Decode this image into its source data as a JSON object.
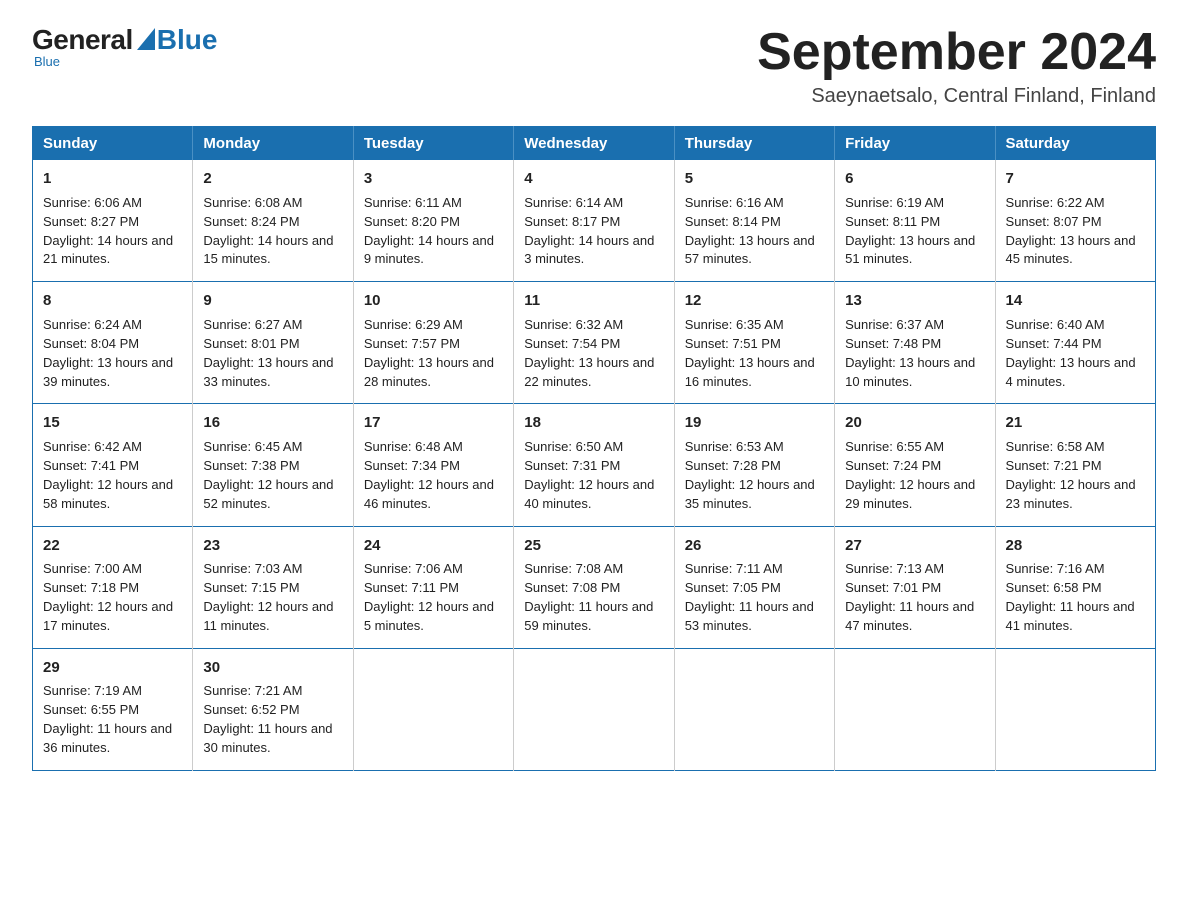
{
  "logo": {
    "general": "General",
    "blue": "Blue",
    "subtitle": "Blue"
  },
  "header": {
    "month_title": "September 2024",
    "location": "Saeynaetsalo, Central Finland, Finland"
  },
  "weekdays": [
    "Sunday",
    "Monday",
    "Tuesday",
    "Wednesday",
    "Thursday",
    "Friday",
    "Saturday"
  ],
  "weeks": [
    [
      {
        "day": "1",
        "sunrise": "Sunrise: 6:06 AM",
        "sunset": "Sunset: 8:27 PM",
        "daylight": "Daylight: 14 hours and 21 minutes."
      },
      {
        "day": "2",
        "sunrise": "Sunrise: 6:08 AM",
        "sunset": "Sunset: 8:24 PM",
        "daylight": "Daylight: 14 hours and 15 minutes."
      },
      {
        "day": "3",
        "sunrise": "Sunrise: 6:11 AM",
        "sunset": "Sunset: 8:20 PM",
        "daylight": "Daylight: 14 hours and 9 minutes."
      },
      {
        "day": "4",
        "sunrise": "Sunrise: 6:14 AM",
        "sunset": "Sunset: 8:17 PM",
        "daylight": "Daylight: 14 hours and 3 minutes."
      },
      {
        "day": "5",
        "sunrise": "Sunrise: 6:16 AM",
        "sunset": "Sunset: 8:14 PM",
        "daylight": "Daylight: 13 hours and 57 minutes."
      },
      {
        "day": "6",
        "sunrise": "Sunrise: 6:19 AM",
        "sunset": "Sunset: 8:11 PM",
        "daylight": "Daylight: 13 hours and 51 minutes."
      },
      {
        "day": "7",
        "sunrise": "Sunrise: 6:22 AM",
        "sunset": "Sunset: 8:07 PM",
        "daylight": "Daylight: 13 hours and 45 minutes."
      }
    ],
    [
      {
        "day": "8",
        "sunrise": "Sunrise: 6:24 AM",
        "sunset": "Sunset: 8:04 PM",
        "daylight": "Daylight: 13 hours and 39 minutes."
      },
      {
        "day": "9",
        "sunrise": "Sunrise: 6:27 AM",
        "sunset": "Sunset: 8:01 PM",
        "daylight": "Daylight: 13 hours and 33 minutes."
      },
      {
        "day": "10",
        "sunrise": "Sunrise: 6:29 AM",
        "sunset": "Sunset: 7:57 PM",
        "daylight": "Daylight: 13 hours and 28 minutes."
      },
      {
        "day": "11",
        "sunrise": "Sunrise: 6:32 AM",
        "sunset": "Sunset: 7:54 PM",
        "daylight": "Daylight: 13 hours and 22 minutes."
      },
      {
        "day": "12",
        "sunrise": "Sunrise: 6:35 AM",
        "sunset": "Sunset: 7:51 PM",
        "daylight": "Daylight: 13 hours and 16 minutes."
      },
      {
        "day": "13",
        "sunrise": "Sunrise: 6:37 AM",
        "sunset": "Sunset: 7:48 PM",
        "daylight": "Daylight: 13 hours and 10 minutes."
      },
      {
        "day": "14",
        "sunrise": "Sunrise: 6:40 AM",
        "sunset": "Sunset: 7:44 PM",
        "daylight": "Daylight: 13 hours and 4 minutes."
      }
    ],
    [
      {
        "day": "15",
        "sunrise": "Sunrise: 6:42 AM",
        "sunset": "Sunset: 7:41 PM",
        "daylight": "Daylight: 12 hours and 58 minutes."
      },
      {
        "day": "16",
        "sunrise": "Sunrise: 6:45 AM",
        "sunset": "Sunset: 7:38 PM",
        "daylight": "Daylight: 12 hours and 52 minutes."
      },
      {
        "day": "17",
        "sunrise": "Sunrise: 6:48 AM",
        "sunset": "Sunset: 7:34 PM",
        "daylight": "Daylight: 12 hours and 46 minutes."
      },
      {
        "day": "18",
        "sunrise": "Sunrise: 6:50 AM",
        "sunset": "Sunset: 7:31 PM",
        "daylight": "Daylight: 12 hours and 40 minutes."
      },
      {
        "day": "19",
        "sunrise": "Sunrise: 6:53 AM",
        "sunset": "Sunset: 7:28 PM",
        "daylight": "Daylight: 12 hours and 35 minutes."
      },
      {
        "day": "20",
        "sunrise": "Sunrise: 6:55 AM",
        "sunset": "Sunset: 7:24 PM",
        "daylight": "Daylight: 12 hours and 29 minutes."
      },
      {
        "day": "21",
        "sunrise": "Sunrise: 6:58 AM",
        "sunset": "Sunset: 7:21 PM",
        "daylight": "Daylight: 12 hours and 23 minutes."
      }
    ],
    [
      {
        "day": "22",
        "sunrise": "Sunrise: 7:00 AM",
        "sunset": "Sunset: 7:18 PM",
        "daylight": "Daylight: 12 hours and 17 minutes."
      },
      {
        "day": "23",
        "sunrise": "Sunrise: 7:03 AM",
        "sunset": "Sunset: 7:15 PM",
        "daylight": "Daylight: 12 hours and 11 minutes."
      },
      {
        "day": "24",
        "sunrise": "Sunrise: 7:06 AM",
        "sunset": "Sunset: 7:11 PM",
        "daylight": "Daylight: 12 hours and 5 minutes."
      },
      {
        "day": "25",
        "sunrise": "Sunrise: 7:08 AM",
        "sunset": "Sunset: 7:08 PM",
        "daylight": "Daylight: 11 hours and 59 minutes."
      },
      {
        "day": "26",
        "sunrise": "Sunrise: 7:11 AM",
        "sunset": "Sunset: 7:05 PM",
        "daylight": "Daylight: 11 hours and 53 minutes."
      },
      {
        "day": "27",
        "sunrise": "Sunrise: 7:13 AM",
        "sunset": "Sunset: 7:01 PM",
        "daylight": "Daylight: 11 hours and 47 minutes."
      },
      {
        "day": "28",
        "sunrise": "Sunrise: 7:16 AM",
        "sunset": "Sunset: 6:58 PM",
        "daylight": "Daylight: 11 hours and 41 minutes."
      }
    ],
    [
      {
        "day": "29",
        "sunrise": "Sunrise: 7:19 AM",
        "sunset": "Sunset: 6:55 PM",
        "daylight": "Daylight: 11 hours and 36 minutes."
      },
      {
        "day": "30",
        "sunrise": "Sunrise: 7:21 AM",
        "sunset": "Sunset: 6:52 PM",
        "daylight": "Daylight: 11 hours and 30 minutes."
      },
      null,
      null,
      null,
      null,
      null
    ]
  ]
}
